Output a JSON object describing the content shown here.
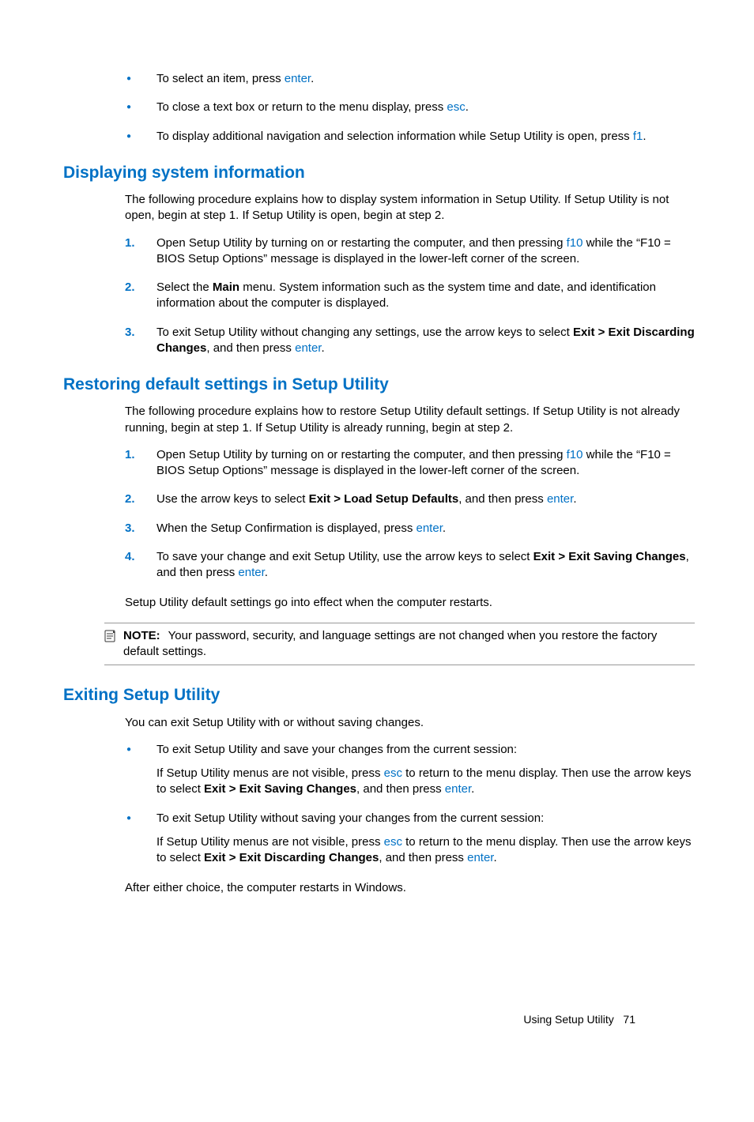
{
  "top_bullets": [
    {
      "pre": "To select an item, press ",
      "key": "enter",
      "post": "."
    },
    {
      "pre": "To close a text box or return to the menu display, press ",
      "key": "esc",
      "post": "."
    },
    {
      "pre": "To display additional navigation and selection information while Setup Utility is open, press ",
      "key": "f1",
      "post": "."
    }
  ],
  "s1": {
    "heading": "Displaying system information",
    "intro": "The following procedure explains how to display system information in Setup Utility. If Setup Utility is not open, begin at step 1. If Setup Utility is open, begin at step 2.",
    "items": {
      "i1a": "Open Setup Utility by turning on or restarting the computer, and then pressing ",
      "i1key": "f10",
      "i1b": " while the “F10 = BIOS Setup Options” message is displayed in the lower-left corner of the screen.",
      "i2a": "Select the ",
      "i2bold": "Main",
      "i2b": " menu. System information such as the system time and date, and identification information about the computer is displayed.",
      "i3a": "To exit Setup Utility without changing any settings, use the arrow keys to select ",
      "i3bold": "Exit > Exit Discarding Changes",
      "i3b": ", and then press ",
      "i3key": "enter",
      "i3c": "."
    }
  },
  "s2": {
    "heading": "Restoring default settings in Setup Utility",
    "intro": "The following procedure explains how to restore Setup Utility default settings. If Setup Utility is not already running, begin at step 1. If Setup Utility is already running, begin at step 2.",
    "items": {
      "i1a": "Open Setup Utility by turning on or restarting the computer, and then pressing ",
      "i1key": "f10",
      "i1b": " while the “F10 = BIOS Setup Options” message is displayed in the lower-left corner of the screen.",
      "i2a": "Use the arrow keys to select ",
      "i2bold": "Exit > Load Setup Defaults",
      "i2b": ", and then press ",
      "i2key": "enter",
      "i2c": ".",
      "i3a": "When the Setup Confirmation is displayed, press ",
      "i3key": "enter",
      "i3b": ".",
      "i4a": "To save your change and exit Setup Utility, use the arrow keys to select ",
      "i4bold": "Exit > Exit Saving Changes",
      "i4b": ", and then press ",
      "i4key": "enter",
      "i4c": "."
    },
    "closing": "Setup Utility default settings go into effect when the computer restarts.",
    "note_label": "NOTE:",
    "note_text": "Your password, security, and language settings are not changed when you restore the factory default settings."
  },
  "s3": {
    "heading": "Exiting Setup Utility",
    "intro": "You can exit Setup Utility with or without saving changes.",
    "b1": {
      "lead": "To exit Setup Utility and save your changes from the current session:",
      "p1": "If Setup Utility menus are not visible, press ",
      "k1": "esc",
      "p2": " to return to the menu display. Then use the arrow keys to select ",
      "bold": "Exit > Exit Saving Changes",
      "p3": ", and then press ",
      "k2": "enter",
      "p4": "."
    },
    "b2": {
      "lead": "To exit Setup Utility without saving your changes from the current session:",
      "p1": "If Setup Utility menus are not visible, press ",
      "k1": "esc",
      "p2": " to return to the menu display. Then use the arrow keys to select ",
      "bold": "Exit > Exit Discarding Changes",
      "p3": ", and then press ",
      "k2": "enter",
      "p4": "."
    },
    "closing": "After either choice, the computer restarts in Windows."
  },
  "footer": {
    "label": "Using Setup Utility",
    "page": "71"
  }
}
